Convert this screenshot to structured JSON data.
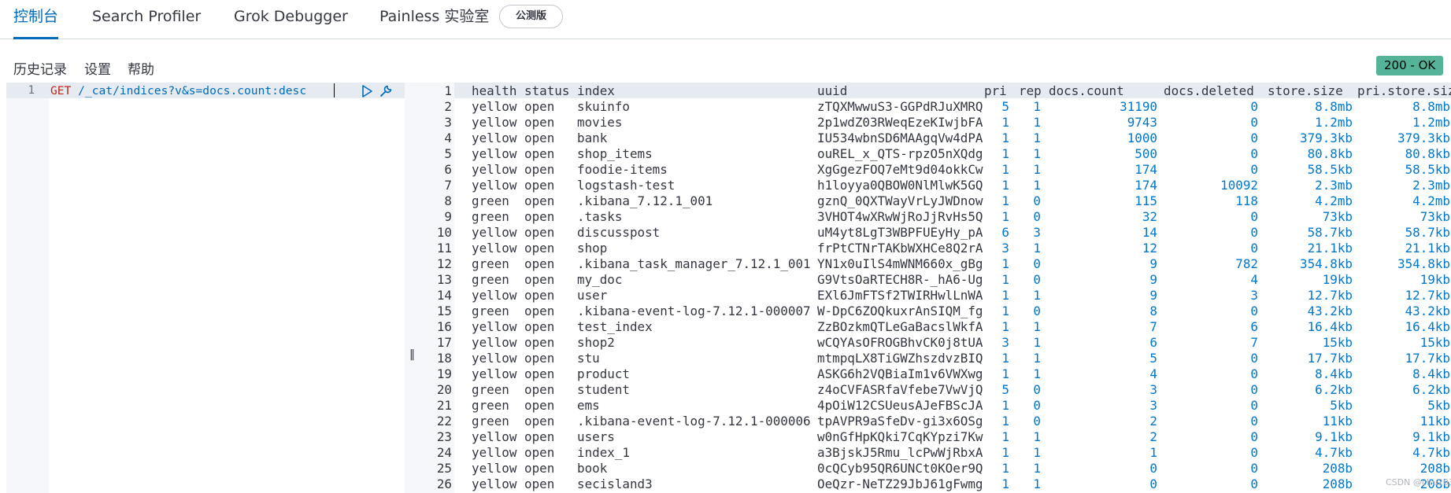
{
  "tabs": [
    {
      "label": "控制台",
      "active": true
    },
    {
      "label": "Search Profiler",
      "active": false
    },
    {
      "label": "Grok Debugger",
      "active": false
    },
    {
      "label": "Painless 实验室",
      "active": false
    }
  ],
  "beta_badge": "公测版",
  "subnav": {
    "history": "历史记录",
    "settings": "设置",
    "help": "帮助"
  },
  "status_badge": "200 - OK",
  "colors": {
    "accent": "#006bb8",
    "status_ok": "#54b399",
    "method": "#bd271e",
    "number": "#0077cc"
  },
  "request": {
    "line_number": "1",
    "method": "GET",
    "path": "/_cat/indices?v&s=docs.count:desc"
  },
  "resizer_icon": "drag-handle-icon",
  "output": {
    "header": {
      "line": "1",
      "cols": [
        "health",
        "status",
        "index",
        "uuid",
        "pri",
        "rep",
        "docs.count",
        "docs.deleted",
        "store.size",
        "pri.store.size"
      ]
    },
    "rows": [
      {
        "ln": "2",
        "health": "yellow",
        "status": "open",
        "index": "skuinfo",
        "uuid": "zTQXMwwuS3-GGPdRJuXMRQ",
        "pri": "5",
        "rep": "1",
        "docs": "31190",
        "deleted": "0",
        "store": "8.8mb",
        "pstore": "8.8mb"
      },
      {
        "ln": "3",
        "health": "yellow",
        "status": "open",
        "index": "movies",
        "uuid": "2p1wdZ03RWeqEzeKIwjbFA",
        "pri": "1",
        "rep": "1",
        "docs": "9743",
        "deleted": "0",
        "store": "1.2mb",
        "pstore": "1.2mb"
      },
      {
        "ln": "4",
        "health": "yellow",
        "status": "open",
        "index": "bank",
        "uuid": "IU534wbnSD6MAAgqVw4dPA",
        "pri": "1",
        "rep": "1",
        "docs": "1000",
        "deleted": "0",
        "store": "379.3kb",
        "pstore": "379.3kb"
      },
      {
        "ln": "5",
        "health": "yellow",
        "status": "open",
        "index": "shop_items",
        "uuid": "ouREL_x_QTS-rpzO5nXQdg",
        "pri": "1",
        "rep": "1",
        "docs": "500",
        "deleted": "0",
        "store": "80.8kb",
        "pstore": "80.8kb"
      },
      {
        "ln": "6",
        "health": "yellow",
        "status": "open",
        "index": "foodie-items",
        "uuid": "XgGgezFOQ7eMt9d04okkCw",
        "pri": "1",
        "rep": "1",
        "docs": "174",
        "deleted": "0",
        "store": "58.5kb",
        "pstore": "58.5kb"
      },
      {
        "ln": "7",
        "health": "yellow",
        "status": "open",
        "index": "logstash-test",
        "uuid": "h1loyya0QBOW0NlMlwK5GQ",
        "pri": "1",
        "rep": "1",
        "docs": "174",
        "deleted": "10092",
        "store": "2.3mb",
        "pstore": "2.3mb"
      },
      {
        "ln": "8",
        "health": "green",
        "status": "open",
        "index": ".kibana_7.12.1_001",
        "uuid": "gznQ_0QXTWayVrLyJWDnow",
        "pri": "1",
        "rep": "0",
        "docs": "115",
        "deleted": "118",
        "store": "4.2mb",
        "pstore": "4.2mb"
      },
      {
        "ln": "9",
        "health": "green",
        "status": "open",
        "index": ".tasks",
        "uuid": "3VHOT4wXRwWjRoJjRvHs5Q",
        "pri": "1",
        "rep": "0",
        "docs": "32",
        "deleted": "0",
        "store": "73kb",
        "pstore": "73kb"
      },
      {
        "ln": "10",
        "health": "yellow",
        "status": "open",
        "index": "discusspost",
        "uuid": "uM4yt8LgT3WBPFUEyHy_pA",
        "pri": "6",
        "rep": "3",
        "docs": "14",
        "deleted": "0",
        "store": "58.7kb",
        "pstore": "58.7kb"
      },
      {
        "ln": "11",
        "health": "yellow",
        "status": "open",
        "index": "shop",
        "uuid": "frPtCTNrTAKbWXHCe8Q2rA",
        "pri": "3",
        "rep": "1",
        "docs": "12",
        "deleted": "0",
        "store": "21.1kb",
        "pstore": "21.1kb"
      },
      {
        "ln": "12",
        "health": "green",
        "status": "open",
        "index": ".kibana_task_manager_7.12.1_001",
        "uuid": "YN1x0uIlS4mWNM660x_gBg",
        "pri": "1",
        "rep": "0",
        "docs": "9",
        "deleted": "782",
        "store": "354.8kb",
        "pstore": "354.8kb"
      },
      {
        "ln": "13",
        "health": "green",
        "status": "open",
        "index": "my_doc",
        "uuid": "G9VtsOaRTECH8R-_hA6-Ug",
        "pri": "1",
        "rep": "0",
        "docs": "9",
        "deleted": "4",
        "store": "19kb",
        "pstore": "19kb"
      },
      {
        "ln": "14",
        "health": "yellow",
        "status": "open",
        "index": "user",
        "uuid": "EXl6JmFTSf2TWIRHwlLnWA",
        "pri": "1",
        "rep": "1",
        "docs": "9",
        "deleted": "3",
        "store": "12.7kb",
        "pstore": "12.7kb"
      },
      {
        "ln": "15",
        "health": "green",
        "status": "open",
        "index": ".kibana-event-log-7.12.1-000007",
        "uuid": "W-DpC6ZOQkuxrAnSIQM_fg",
        "pri": "1",
        "rep": "0",
        "docs": "8",
        "deleted": "0",
        "store": "43.2kb",
        "pstore": "43.2kb"
      },
      {
        "ln": "16",
        "health": "yellow",
        "status": "open",
        "index": "test_index",
        "uuid": "ZzBOzkmQTLeGaBacslWkfA",
        "pri": "1",
        "rep": "1",
        "docs": "7",
        "deleted": "6",
        "store": "16.4kb",
        "pstore": "16.4kb"
      },
      {
        "ln": "17",
        "health": "yellow",
        "status": "open",
        "index": "shop2",
        "uuid": "wCQYAsOFROGBhvCK0j8tUA",
        "pri": "3",
        "rep": "1",
        "docs": "6",
        "deleted": "7",
        "store": "15kb",
        "pstore": "15kb"
      },
      {
        "ln": "18",
        "health": "yellow",
        "status": "open",
        "index": "stu",
        "uuid": "mtmpqLX8TiGWZhszdvzBIQ",
        "pri": "1",
        "rep": "1",
        "docs": "5",
        "deleted": "0",
        "store": "17.7kb",
        "pstore": "17.7kb"
      },
      {
        "ln": "19",
        "health": "yellow",
        "status": "open",
        "index": "product",
        "uuid": "ASKG6h2VQBiaIm1v6VWXwg",
        "pri": "1",
        "rep": "1",
        "docs": "4",
        "deleted": "0",
        "store": "8.4kb",
        "pstore": "8.4kb"
      },
      {
        "ln": "20",
        "health": "green",
        "status": "open",
        "index": "student",
        "uuid": "z4oCVFASRfaVfebe7VwVjQ",
        "pri": "5",
        "rep": "0",
        "docs": "3",
        "deleted": "0",
        "store": "6.2kb",
        "pstore": "6.2kb"
      },
      {
        "ln": "21",
        "health": "green",
        "status": "open",
        "index": "ems",
        "uuid": "4pOiW12CSUeusAJeFBScJA",
        "pri": "1",
        "rep": "0",
        "docs": "3",
        "deleted": "0",
        "store": "5kb",
        "pstore": "5kb"
      },
      {
        "ln": "22",
        "health": "green",
        "status": "open",
        "index": ".kibana-event-log-7.12.1-000006",
        "uuid": "tpAVPR9aSfeDv-gi3x6OSg",
        "pri": "1",
        "rep": "0",
        "docs": "2",
        "deleted": "0",
        "store": "11kb",
        "pstore": "11kb"
      },
      {
        "ln": "23",
        "health": "yellow",
        "status": "open",
        "index": "users",
        "uuid": "w0nGfHpKQki7CqKYpzi7Kw",
        "pri": "1",
        "rep": "1",
        "docs": "2",
        "deleted": "0",
        "store": "9.1kb",
        "pstore": "9.1kb"
      },
      {
        "ln": "24",
        "health": "yellow",
        "status": "open",
        "index": "index_1",
        "uuid": "a3BjskJ5Rmu_lcPwWjRbxA",
        "pri": "1",
        "rep": "1",
        "docs": "1",
        "deleted": "0",
        "store": "4.7kb",
        "pstore": "4.7kb"
      },
      {
        "ln": "25",
        "health": "yellow",
        "status": "open",
        "index": "book",
        "uuid": "0cQCyb95QR6UNCt0KOer9Q",
        "pri": "1",
        "rep": "1",
        "docs": "0",
        "deleted": "0",
        "store": "208b",
        "pstore": "208b"
      },
      {
        "ln": "26",
        "health": "yellow",
        "status": "open",
        "index": "secisland3",
        "uuid": "OeQzr-NeTZ29JbJ61gFwmg",
        "pri": "1",
        "rep": "1",
        "docs": "0",
        "deleted": "0",
        "store": "208b",
        "pstore": "208b"
      }
    ]
  },
  "watermark": "CSDN @chu2030"
}
